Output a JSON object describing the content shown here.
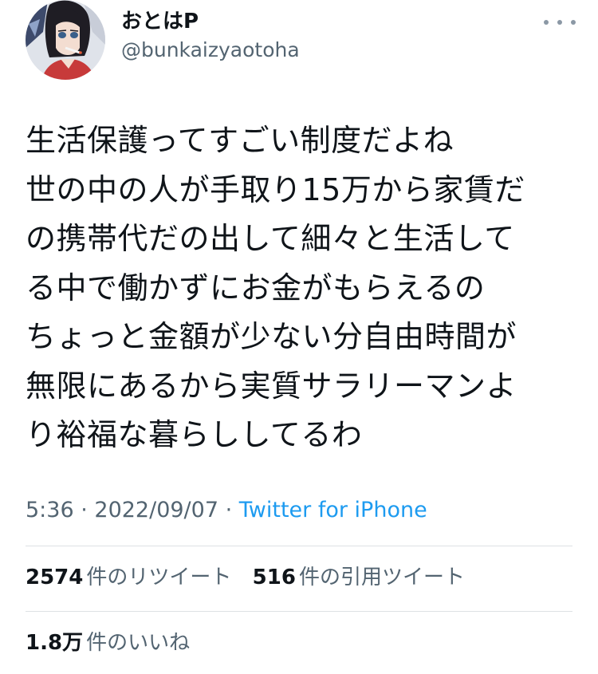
{
  "user": {
    "display_name": "おとはP",
    "handle": "@bunkaizyaotoha",
    "avatar_icon": "anime-girl-avatar"
  },
  "menu": {
    "icon": "more-dots-icon"
  },
  "tweet": {
    "lines": [
      "生活保護ってすごい制度だよね",
      "世の中の人が手取り15万から家賃だ",
      "の携帯代だの出して細々と生活して",
      "る中で働かずにお金がもらえるの",
      "ちょっと金額が少ない分自由時間が",
      "無限にあるから実質サラリーマンよ",
      "り裕福な暮らししてるわ"
    ]
  },
  "meta": {
    "time": "5:36",
    "separator": " · ",
    "date": "2022/09/07",
    "source": "Twitter for iPhone"
  },
  "stats": {
    "retweets": {
      "count": "2574",
      "label": "件のリツイート"
    },
    "quotes": {
      "count": "516",
      "label": "件の引用ツイート"
    },
    "likes": {
      "count": "1.8万",
      "label": "件のいいね"
    }
  },
  "colors": {
    "text_primary": "#0f1419",
    "text_secondary": "#536471",
    "link": "#1d9bf0",
    "divider": "#dde1e4"
  }
}
